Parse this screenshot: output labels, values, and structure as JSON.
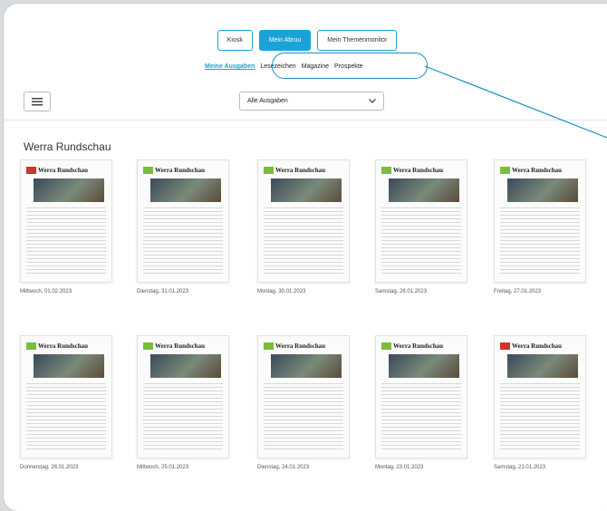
{
  "tabs": [
    {
      "label": "Kiosk",
      "active": false
    },
    {
      "label": "Mein Abruu",
      "active": true
    },
    {
      "label": "Mein Themenmonitor",
      "active": false
    }
  ],
  "subnav": [
    {
      "label": "Meine Ausgaben",
      "active": true
    },
    {
      "label": "Lesezeichen",
      "active": false
    },
    {
      "label": "Magazine",
      "active": false
    },
    {
      "label": "Prospekte",
      "active": false
    }
  ],
  "filter": {
    "value": "Alle Ausgaben"
  },
  "section_title": "Werra Rundschau",
  "masthead": "Werra Rundschau",
  "issues": [
    {
      "date": "Mittwoch, 01.02.2023",
      "logo": "red"
    },
    {
      "date": "Dienstag, 31.01.2023",
      "logo": "green"
    },
    {
      "date": "Montag, 30.01.2023",
      "logo": "green"
    },
    {
      "date": "Samstag, 28.01.2023",
      "logo": "green"
    },
    {
      "date": "Freitag, 27.01.2023",
      "logo": "green"
    },
    {
      "date": "Donnerstag, 26.01.2023",
      "logo": "green"
    },
    {
      "date": "Mittwoch, 25.01.2023",
      "logo": "green"
    },
    {
      "date": "Dienstag, 24.01.2023",
      "logo": "green"
    },
    {
      "date": "Montag, 23.01.2023",
      "logo": "green"
    },
    {
      "date": "Samstag, 21.01.2023",
      "logo": "red"
    }
  ],
  "colors": {
    "accent": "#1aa3d6",
    "logo_green": "#7bbd3a",
    "logo_red": "#d2332b"
  }
}
